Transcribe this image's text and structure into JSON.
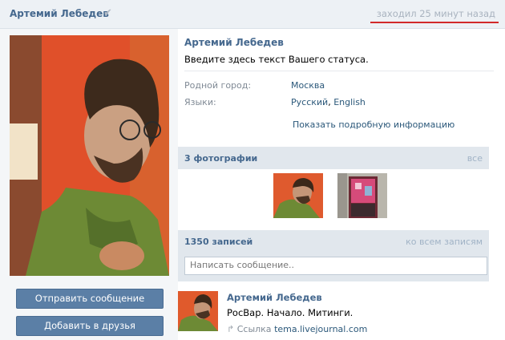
{
  "header": {
    "name": "Артемий Лебедев",
    "verified_icon": "checkmark-icon",
    "last_seen": "заходил 25 минут назад",
    "last_seen_underline_color": "#d22a2a"
  },
  "sidebar": {
    "send_message": "Отправить сообщение",
    "add_friend": "Добавить в друзья"
  },
  "profile": {
    "name": "Артемий Лебедев",
    "status": "Введите здесь текст Вашего статуса.",
    "city_label": "Родной город:",
    "city_value": "Москва",
    "languages_label": "Языки:",
    "language_1": "Русский",
    "language_sep": ", ",
    "language_2": "English",
    "show_more": "Показать подробную информацию"
  },
  "photos": {
    "title": "3 фотографии",
    "all_link": "все"
  },
  "wall": {
    "title": "1350 записей",
    "all_link": "ко всем записям",
    "compose_placeholder": "Написать сообщение.."
  },
  "post": {
    "author": "Артемий Лебедев",
    "text": "РосВар. Начало. Митинги.",
    "link_icon": "share-arrow-icon",
    "link_prefix": "Ссылка",
    "link_domain": "tema.livejournal.com"
  },
  "colors": {
    "accent": "#45688e",
    "link": "#2b587a",
    "button": "#5b7fa6",
    "bar": "#e1e7ed"
  }
}
